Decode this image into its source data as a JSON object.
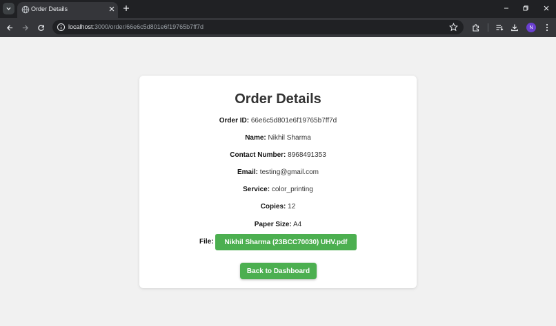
{
  "browser": {
    "tab": {
      "title": "Order Details"
    },
    "address": {
      "host": "localhost",
      "path": ":3000/order/66e6c5d801e6f19765b7ff7d"
    },
    "profile_initial": "N"
  },
  "order": {
    "title": "Order Details",
    "fields": [
      {
        "label": "Order ID:",
        "value": "66e6c5d801e6f19765b7ff7d"
      },
      {
        "label": "Name:",
        "value": "Nikhil Sharma"
      },
      {
        "label": "Contact Number:",
        "value": "8968491353"
      },
      {
        "label": "Email:",
        "value": "testing@gmail.com"
      },
      {
        "label": "Service:",
        "value": "color_printing"
      },
      {
        "label": "Copies:",
        "value": "12"
      },
      {
        "label": "Paper Size:",
        "value": "A4"
      }
    ],
    "file": {
      "label": "File:",
      "name": "Nikhil Sharma (23BCC70030) UHV.pdf"
    },
    "back_button": "Back to Dashboard"
  },
  "colors": {
    "accent": "#4caf50",
    "chrome_dark": "#202124",
    "chrome_toolbar": "#35363a"
  }
}
